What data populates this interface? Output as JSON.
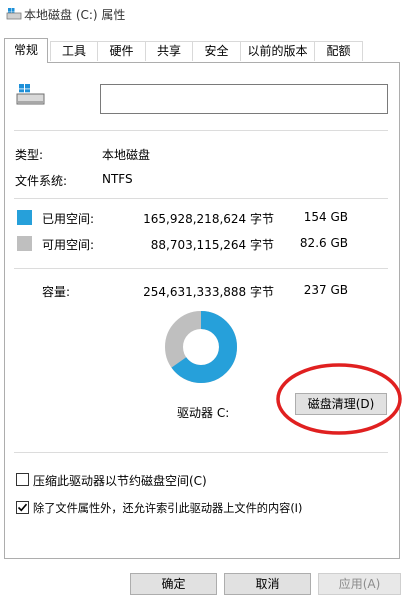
{
  "window": {
    "title": "本地磁盘 (C:) 属性"
  },
  "tabs": [
    {
      "label": "常规",
      "active": true
    },
    {
      "label": "工具"
    },
    {
      "label": "硬件"
    },
    {
      "label": "共享"
    },
    {
      "label": "安全"
    },
    {
      "label": "以前的版本"
    },
    {
      "label": "配额"
    }
  ],
  "icons": {
    "title": "drive-icon",
    "drive": "drive-icon"
  },
  "general": {
    "name_value": "",
    "type_label": "类型:",
    "type_value": "本地磁盘",
    "fs_label": "文件系统:",
    "fs_value": "NTFS",
    "used_label": "已用空间:",
    "used_bytes": "165,928,218,624 字节",
    "used_size": "154 GB",
    "free_label": "可用空间:",
    "free_bytes": "88,703,115,264 字节",
    "free_size": "82.6 GB",
    "capacity_label": "容量:",
    "capacity_bytes": "254,631,333,888 字节",
    "capacity_size": "237 GB",
    "drive_label": "驱动器 C:",
    "cleanup_button": "磁盘清理(D)",
    "compress_label": "压缩此驱动器以节约磁盘空间(C)",
    "compress_checked": false,
    "index_label": "除了文件属性外，还允许索引此驱动器上文件的内容(I)",
    "index_checked": true
  },
  "usage": {
    "used_fraction": 0.652
  },
  "colors": {
    "used": "#26a0da",
    "free": "#bfbfbf",
    "annotation": "#e02020"
  },
  "footer": {
    "ok": "确定",
    "cancel": "取消",
    "apply": "应用(A)"
  }
}
